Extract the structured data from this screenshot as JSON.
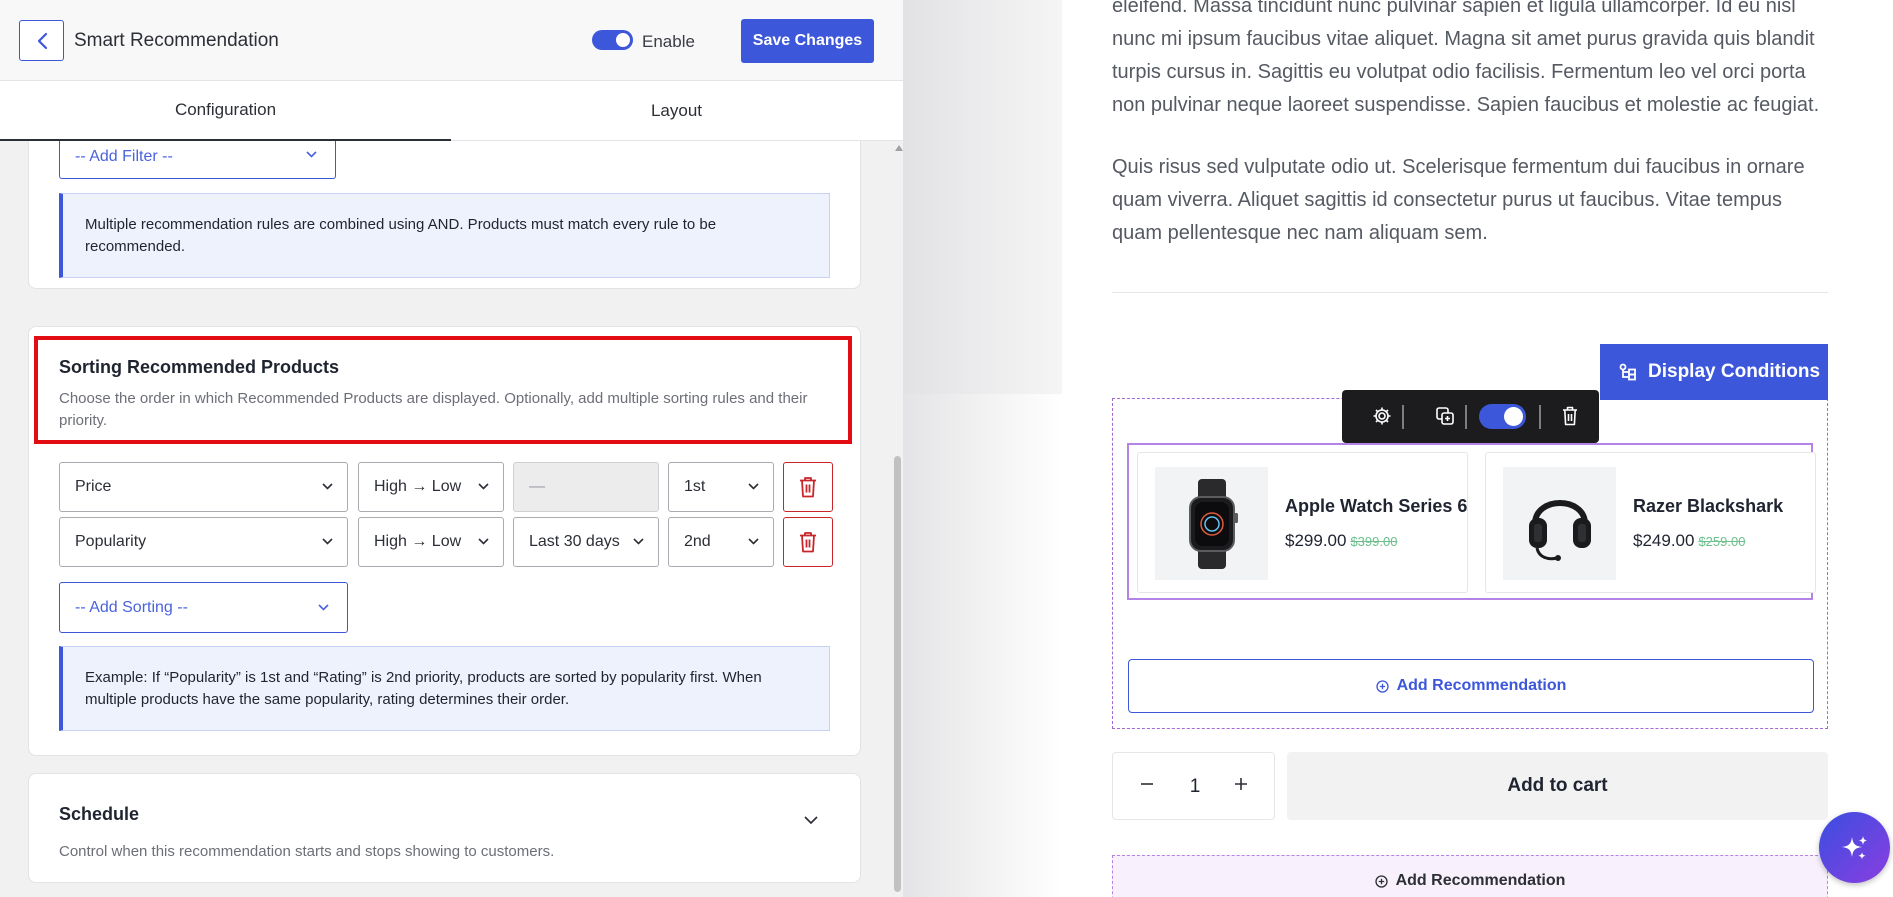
{
  "header": {
    "title": "Smart Recommendation",
    "enable_label": "Enable",
    "enable_on": true,
    "save_label": "Save Changes"
  },
  "tabs": [
    {
      "label": "Configuration",
      "active": true
    },
    {
      "label": "Layout",
      "active": false
    }
  ],
  "filters": {
    "add_filter_label": "-- Add Filter --",
    "note": "Multiple recommendation rules are combined using AND. Products must match every rule to be recommended."
  },
  "sorting": {
    "title": "Sorting Recommended Products",
    "description": "Choose the order in which Recommended Products are displayed. Optionally, add multiple sorting rules and their priority.",
    "rules": [
      {
        "field": "Price",
        "direction": "High → Low",
        "period": "—",
        "priority": "1st"
      },
      {
        "field": "Popularity",
        "direction": "High → Low",
        "period": "Last 30 days",
        "priority": "2nd"
      }
    ],
    "add_sorting_label": "-- Add Sorting --",
    "note": "Example: If “Popularity” is 1st and “Rating” is 2nd priority, products are sorted by popularity first. When multiple products have the same popularity, rating determines their order."
  },
  "schedule": {
    "title": "Schedule",
    "description": "Control when this recommendation starts and stops showing to customers."
  },
  "preview": {
    "paragraph_1": "eleifend. Massa tincidunt nunc pulvinar sapien et ligula ullamcorper. Id eu nisl nunc mi ipsum faucibus vitae aliquet. Magna sit amet purus gravida quis blandit turpis cursus in. Sagittis eu volutpat odio facilisis. Fermentum leo vel orci porta non pulvinar neque laoreet suspendisse. Sapien faucibus et molestie ac feugiat.",
    "paragraph_2": "Quis risus sed vulputate odio ut. Scelerisque fermentum dui faucibus in ornare quam viverra. Aliquet sagittis id consectetur purus ut faucibus. Vitae tempus quam pellentesque nec nam aliquam sem.",
    "display_conditions_label": "Display Conditions",
    "toolbar_toggle_on": true,
    "products": [
      {
        "name": "Apple Watch Series 6",
        "price": "$299.00",
        "old_price": "$399.00",
        "icon": "watch-icon"
      },
      {
        "name": "Razer Blackshark",
        "price": "$249.00",
        "old_price": "$259.00",
        "icon": "headphones-icon"
      }
    ],
    "add_recommendation_label": "Add Recommendation",
    "quantity": "1",
    "add_to_cart_label": "Add to cart"
  },
  "colors": {
    "accent": "#3d57db",
    "highlight": "#e10d13",
    "danger": "#c8262b",
    "sale_price": "#6cc08d",
    "preview_outline": "#b583e6"
  }
}
